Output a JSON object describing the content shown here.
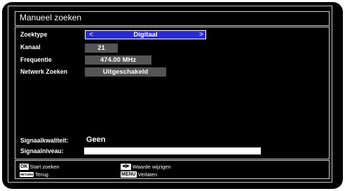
{
  "dialog": {
    "title": "Manueel zoeken"
  },
  "settings": [
    {
      "label": "Zoektype",
      "value": "Digitaal",
      "selected": true
    },
    {
      "label": "Kanaal",
      "value": "21"
    },
    {
      "label": "Frequentie",
      "value": "474.00 MHz"
    },
    {
      "label": "Netwerk Zoeken",
      "value": "Uitgeschakeld"
    }
  ],
  "arrows": {
    "left": "<",
    "right": ">"
  },
  "signal": {
    "quality_label": "Signaalkwaliteit:",
    "quality_value": "Geen",
    "level_label": "Signaalniveau:"
  },
  "footer": {
    "ok_key": "OK",
    "ok_label": "Start zoeken",
    "return_key": "RETURN",
    "return_label": "Terug",
    "arrows_key": "◀|▶",
    "arrows_label": "Waarde wijzigen",
    "menu_key": "MENU",
    "menu_label": "Verlaten"
  },
  "colors": {
    "background": "#000000",
    "selected_field": "#2a2ad2",
    "field": "#555555",
    "text": "#ffffff"
  }
}
